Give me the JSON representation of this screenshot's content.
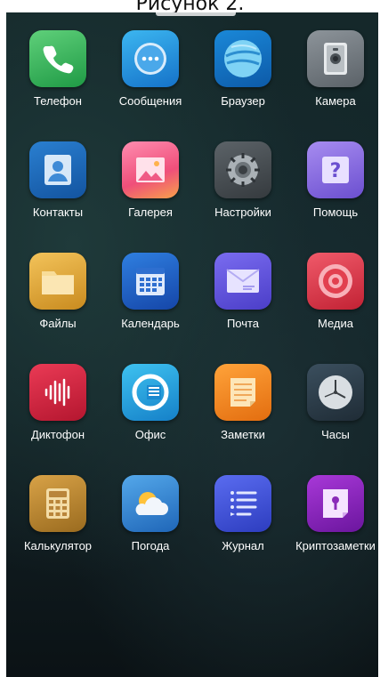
{
  "caption": "Рисунок 2.",
  "apps": [
    {
      "label": "Телефон",
      "icon": "phone-icon"
    },
    {
      "label": "Сообщения",
      "icon": "messages-icon"
    },
    {
      "label": "Браузер",
      "icon": "browser-icon"
    },
    {
      "label": "Камера",
      "icon": "camera-icon"
    },
    {
      "label": "Контакты",
      "icon": "contacts-icon"
    },
    {
      "label": "Галерея",
      "icon": "gallery-icon"
    },
    {
      "label": "Настройки",
      "icon": "settings-icon"
    },
    {
      "label": "Помощь",
      "icon": "help-icon"
    },
    {
      "label": "Файлы",
      "icon": "files-icon"
    },
    {
      "label": "Календарь",
      "icon": "calendar-icon"
    },
    {
      "label": "Почта",
      "icon": "mail-icon"
    },
    {
      "label": "Медиа",
      "icon": "media-icon"
    },
    {
      "label": "Диктофон",
      "icon": "recorder-icon"
    },
    {
      "label": "Офис",
      "icon": "office-icon"
    },
    {
      "label": "Заметки",
      "icon": "notes-icon"
    },
    {
      "label": "Часы",
      "icon": "clock-icon"
    },
    {
      "label": "Калькулятор",
      "icon": "calculator-icon"
    },
    {
      "label": "Погода",
      "icon": "weather-icon"
    },
    {
      "label": "Журнал",
      "icon": "journal-icon"
    },
    {
      "label": "Криптозаметки",
      "icon": "crypto-notes-icon"
    }
  ]
}
